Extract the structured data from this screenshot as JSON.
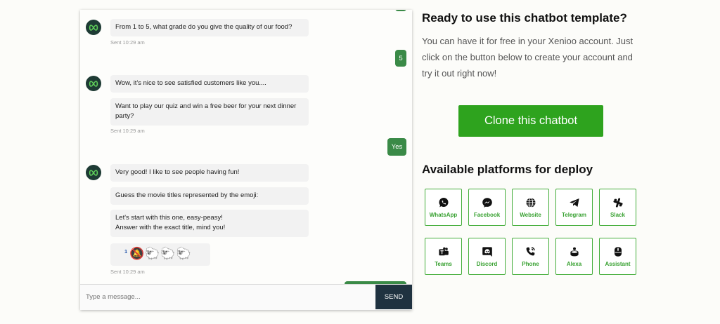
{
  "chat": {
    "group1": {
      "bubble": "From 1 to 5, what grade do you give the quality of our food?",
      "sent": "Sent 10:29 am"
    },
    "reply1": "5",
    "group2": {
      "bubble1": "Wow, it's nice to see satisfied customers like you....",
      "bubble2": "Want to play our quiz and win a free beer for your next dinner\nparty?",
      "sent": "Sent 10:29 am"
    },
    "reply2": "Yes",
    "group3": {
      "bubble1": "Very good! I like to see people having fun!",
      "bubble2": "Guess the movie titles represented by the emoji:",
      "bubble3": "Let's start with this one, easy-peasy!\nAnswer with the exact title, mind you!",
      "emoji_prefix": "1",
      "emoji_sequence": "🔕🐑🐑🐑",
      "sent": "Sent 10:29 am"
    },
    "composer": {
      "placeholder": "Type a message...",
      "send_label": "SEND"
    },
    "colors": {
      "user_bubble": "#3a8a47",
      "bot_bubble": "#f2f2f2",
      "send_button": "#1f3240",
      "avatar": "#1e3b34"
    }
  },
  "panel": {
    "title": "Ready to use this chatbot template?",
    "description": "You can have it for free in your Xenioo account. Just click on the button below to create your account and try it out right now!",
    "clone_button": "Clone this chatbot",
    "platforms_title": "Available platforms for deploy",
    "accent_color": "#2ea31e",
    "platforms": [
      {
        "label": "WhatsApp",
        "icon": "whatsapp-icon"
      },
      {
        "label": "Facebook",
        "icon": "messenger-icon"
      },
      {
        "label": "Website",
        "icon": "globe-icon"
      },
      {
        "label": "Telegram",
        "icon": "telegram-icon"
      },
      {
        "label": "Slack",
        "icon": "slack-icon"
      },
      {
        "label": "Teams",
        "icon": "teams-icon"
      },
      {
        "label": "Discord",
        "icon": "discord-icon"
      },
      {
        "label": "Phone",
        "icon": "phone-icon"
      },
      {
        "label": "Alexa",
        "icon": "alexa-icon"
      },
      {
        "label": "Assistant",
        "icon": "assistant-icon"
      }
    ]
  }
}
